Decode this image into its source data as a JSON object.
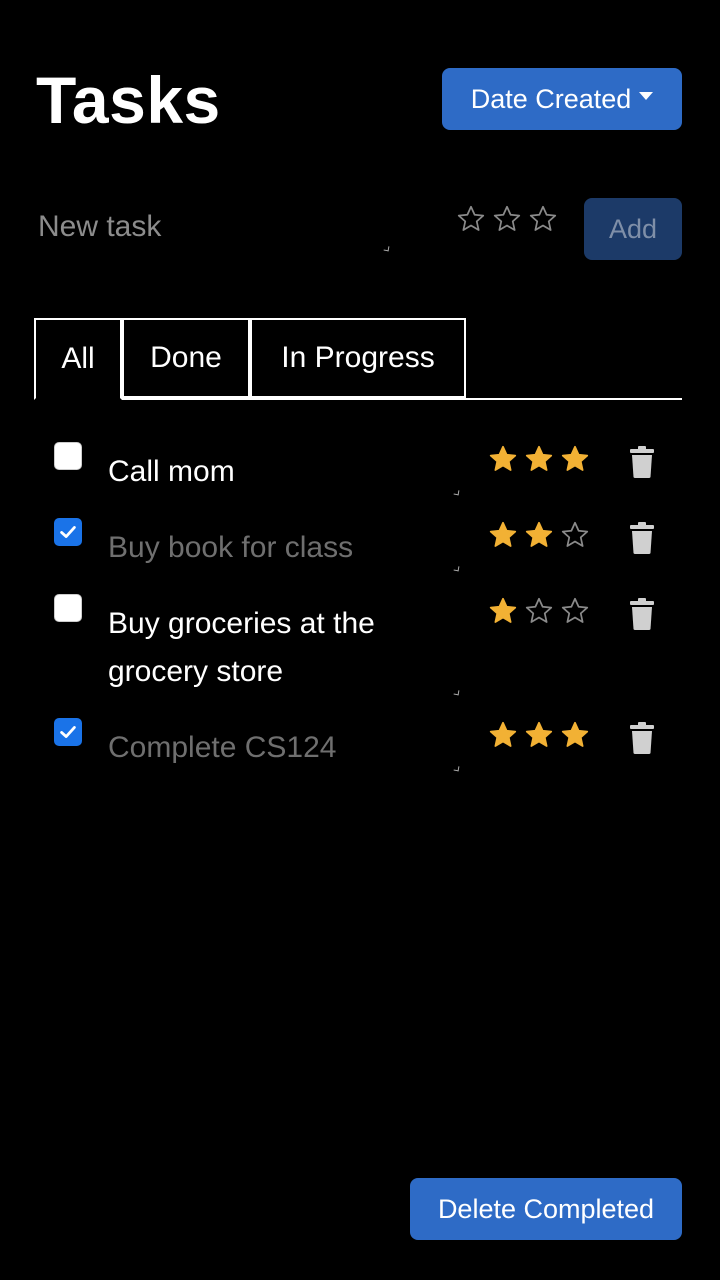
{
  "header": {
    "title": "Tasks",
    "sort_label": "Date Created"
  },
  "new_task": {
    "placeholder": "New task",
    "value": "",
    "rating": 0,
    "max_rating": 3,
    "add_label": "Add"
  },
  "tabs": [
    {
      "label": "All",
      "active": true
    },
    {
      "label": "Done",
      "active": false
    },
    {
      "label": "In Progress",
      "active": false
    }
  ],
  "tasks": [
    {
      "text": "Call mom",
      "done": false,
      "rating": 3
    },
    {
      "text": "Buy book for class",
      "done": true,
      "rating": 2
    },
    {
      "text": "Buy groceries at the grocery store",
      "done": false,
      "rating": 1
    },
    {
      "text": "Complete CS124",
      "done": true,
      "rating": 3
    }
  ],
  "footer": {
    "delete_completed_label": "Delete Completed"
  },
  "icons": {
    "sort_caret": "caret-down-icon",
    "star": "star-icon",
    "delete": "trash-icon",
    "checkbox": "checkmark-icon"
  },
  "colors": {
    "background": "#000000",
    "primary_button": "#2e6bc6",
    "add_button_disabled": "#1c3a68",
    "star_filled": "#f2b134",
    "star_empty_outline": "#8a8a8a",
    "done_text": "#6f6f6f",
    "checkbox_checked": "#1a73e8",
    "trash": "#d0d0d0"
  }
}
